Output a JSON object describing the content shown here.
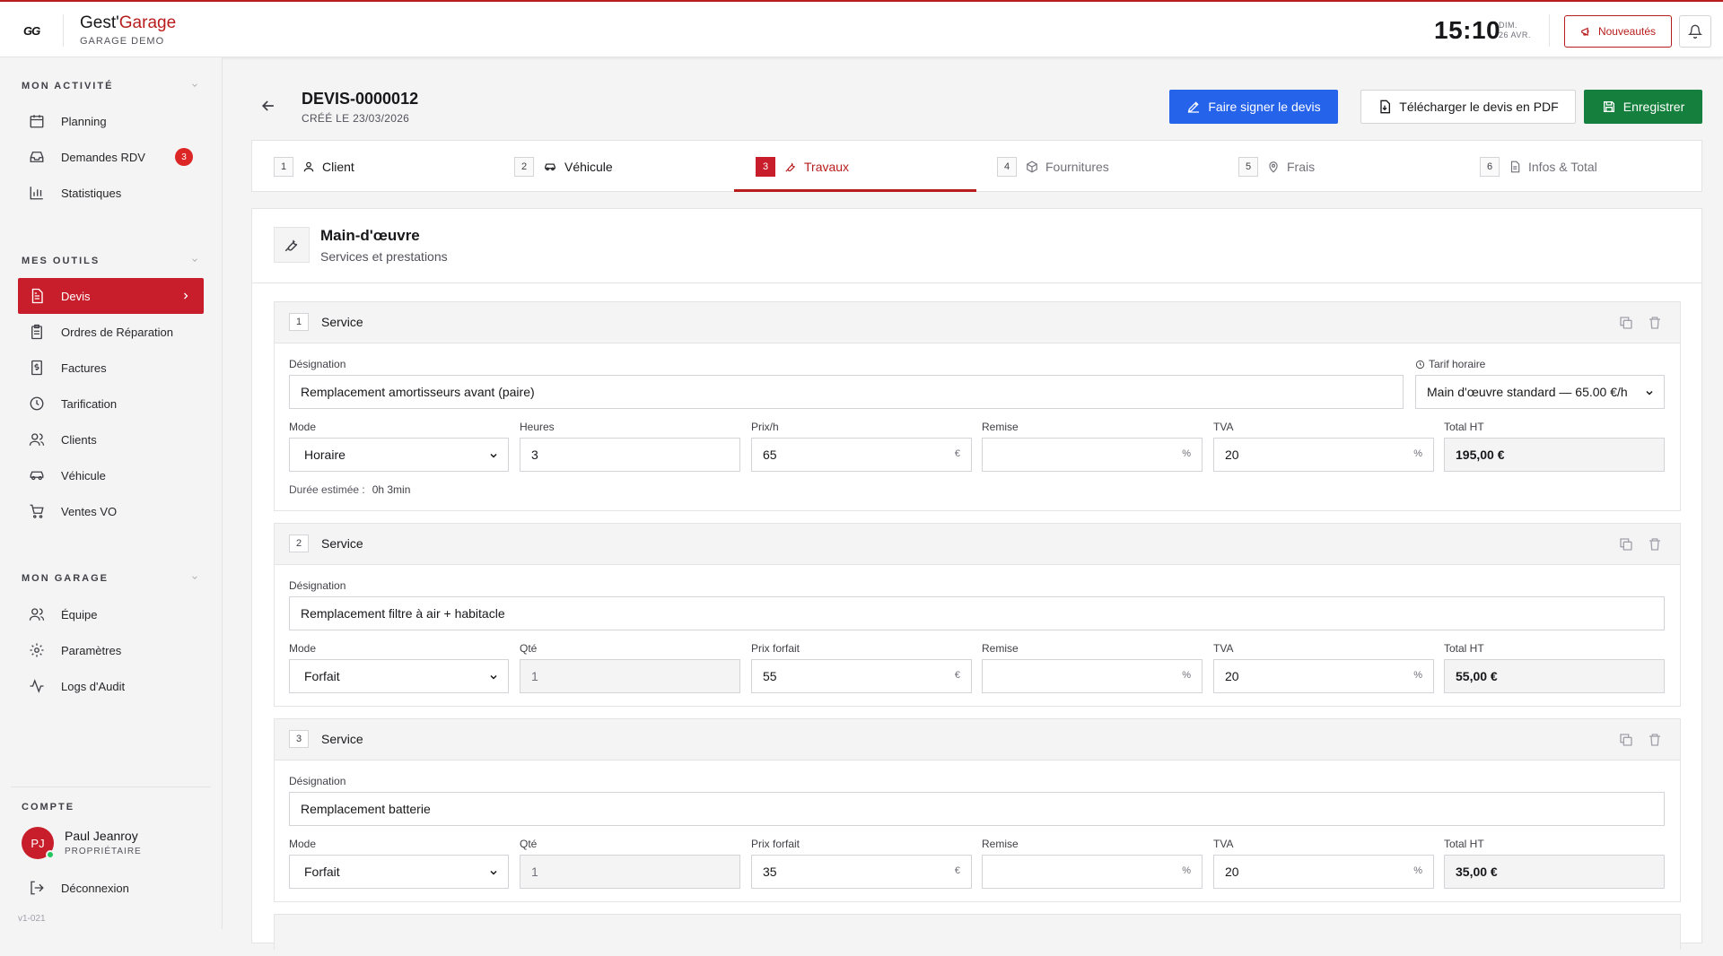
{
  "app": {
    "brand_prefix": "Gest'",
    "brand_suffix": "Garage",
    "garage_name": "GARAGE DEMO",
    "logo_text": "GG"
  },
  "header": {
    "time": "15:10",
    "day": "DIM.",
    "date": "26 AVR.",
    "news_label": "Nouveautés"
  },
  "sidebar": {
    "sections": [
      {
        "title": "MON ACTIVITÉ",
        "items": [
          {
            "label": "Planning",
            "icon": "calendar-icon"
          },
          {
            "label": "Demandes RDV",
            "icon": "inbox-icon",
            "badge": "3"
          },
          {
            "label": "Statistiques",
            "icon": "bar-chart-icon"
          }
        ]
      },
      {
        "title": "MES OUTILS",
        "items": [
          {
            "label": "Devis",
            "icon": "document-icon",
            "active": true
          },
          {
            "label": "Ordres de Réparation",
            "icon": "clipboard-icon"
          },
          {
            "label": "Factures",
            "icon": "invoice-icon"
          },
          {
            "label": "Tarification",
            "icon": "clock-icon"
          },
          {
            "label": "Clients",
            "icon": "users-icon"
          },
          {
            "label": "Véhicule",
            "icon": "car-icon"
          },
          {
            "label": "Ventes VO",
            "icon": "cart-icon"
          }
        ]
      },
      {
        "title": "MON GARAGE",
        "items": [
          {
            "label": "Équipe",
            "icon": "team-icon"
          },
          {
            "label": "Paramètres",
            "icon": "gear-icon"
          },
          {
            "label": "Logs d'Audit",
            "icon": "activity-icon"
          }
        ]
      }
    ],
    "account": {
      "title": "COMPTE",
      "initials": "PJ",
      "name": "Paul Jeanroy",
      "role": "PROPRIÉTAIRE",
      "logout": "Déconnexion"
    },
    "version": "v1-021"
  },
  "page": {
    "title": "DEVIS-0000012",
    "created": "CRÉÉ LE 23/03/2026",
    "actions": {
      "sign": "Faire signer le devis",
      "pdf": "Télécharger le devis en PDF",
      "save": "Enregistrer"
    }
  },
  "tabs": [
    {
      "num": "1",
      "label": "Client",
      "icon": "user-icon"
    },
    {
      "num": "2",
      "label": "Véhicule",
      "icon": "car-icon"
    },
    {
      "num": "3",
      "label": "Travaux",
      "icon": "wrench-icon",
      "active": true
    },
    {
      "num": "4",
      "label": "Fournitures",
      "icon": "box-icon"
    },
    {
      "num": "5",
      "label": "Frais",
      "icon": "map-pin-icon"
    },
    {
      "num": "6",
      "label": "Infos & Total",
      "icon": "file-text-icon"
    }
  ],
  "labour": {
    "title": "Main-d'œuvre",
    "subtitle": "Services et prestations",
    "services": [
      {
        "num": "1",
        "title": "Service",
        "designation_label": "Désignation",
        "designation": "Remplacement amortisseurs avant (paire)",
        "rate_label": "Tarif horaire",
        "rate": "Main d'œuvre standard — 65.00 €/h",
        "mode_label": "Mode",
        "mode": "Horaire",
        "qty_label": "Heures",
        "qty": "3",
        "price_label": "Prix/h",
        "price": "65",
        "price_unit": "€",
        "discount_label": "Remise",
        "discount": "",
        "discount_unit": "%",
        "vat_label": "TVA",
        "vat": "20",
        "vat_unit": "%",
        "total_label": "Total HT",
        "total": "195,00 €",
        "duration_label": "Durée estimée :",
        "duration": "0h 3min"
      },
      {
        "num": "2",
        "title": "Service",
        "designation_label": "Désignation",
        "designation": "Remplacement filtre à air + habitacle",
        "mode_label": "Mode",
        "mode": "Forfait",
        "qty_label": "Qté",
        "qty": "1",
        "price_label": "Prix forfait",
        "price": "55",
        "price_unit": "€",
        "discount_label": "Remise",
        "discount": "",
        "discount_unit": "%",
        "vat_label": "TVA",
        "vat": "20",
        "vat_unit": "%",
        "total_label": "Total HT",
        "total": "55,00 €"
      },
      {
        "num": "3",
        "title": "Service",
        "designation_label": "Désignation",
        "designation": "Remplacement batterie",
        "mode_label": "Mode",
        "mode": "Forfait",
        "qty_label": "Qté",
        "qty": "1",
        "price_label": "Prix forfait",
        "price": "35",
        "price_unit": "€",
        "discount_label": "Remise",
        "discount": "",
        "discount_unit": "%",
        "vat_label": "TVA",
        "vat": "20",
        "vat_unit": "%",
        "total_label": "Total HT",
        "total": "35,00 €"
      }
    ]
  },
  "colors": {
    "accent": "#c81e2b",
    "blue": "#2563eb",
    "green": "#15803d"
  }
}
